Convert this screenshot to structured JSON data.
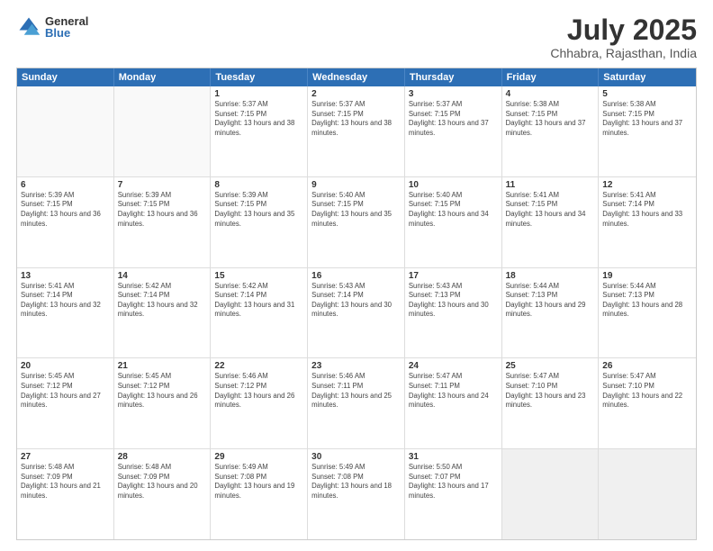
{
  "logo": {
    "general": "General",
    "blue": "Blue"
  },
  "header": {
    "title": "July 2025",
    "subtitle": "Chhabra, Rajasthan, India"
  },
  "calendar": {
    "days": [
      "Sunday",
      "Monday",
      "Tuesday",
      "Wednesday",
      "Thursday",
      "Friday",
      "Saturday"
    ],
    "rows": [
      [
        {
          "day": "",
          "text": ""
        },
        {
          "day": "",
          "text": ""
        },
        {
          "day": "1",
          "text": "Sunrise: 5:37 AM\nSunset: 7:15 PM\nDaylight: 13 hours and 38 minutes."
        },
        {
          "day": "2",
          "text": "Sunrise: 5:37 AM\nSunset: 7:15 PM\nDaylight: 13 hours and 38 minutes."
        },
        {
          "day": "3",
          "text": "Sunrise: 5:37 AM\nSunset: 7:15 PM\nDaylight: 13 hours and 37 minutes."
        },
        {
          "day": "4",
          "text": "Sunrise: 5:38 AM\nSunset: 7:15 PM\nDaylight: 13 hours and 37 minutes."
        },
        {
          "day": "5",
          "text": "Sunrise: 5:38 AM\nSunset: 7:15 PM\nDaylight: 13 hours and 37 minutes."
        }
      ],
      [
        {
          "day": "6",
          "text": "Sunrise: 5:39 AM\nSunset: 7:15 PM\nDaylight: 13 hours and 36 minutes."
        },
        {
          "day": "7",
          "text": "Sunrise: 5:39 AM\nSunset: 7:15 PM\nDaylight: 13 hours and 36 minutes."
        },
        {
          "day": "8",
          "text": "Sunrise: 5:39 AM\nSunset: 7:15 PM\nDaylight: 13 hours and 35 minutes."
        },
        {
          "day": "9",
          "text": "Sunrise: 5:40 AM\nSunset: 7:15 PM\nDaylight: 13 hours and 35 minutes."
        },
        {
          "day": "10",
          "text": "Sunrise: 5:40 AM\nSunset: 7:15 PM\nDaylight: 13 hours and 34 minutes."
        },
        {
          "day": "11",
          "text": "Sunrise: 5:41 AM\nSunset: 7:15 PM\nDaylight: 13 hours and 34 minutes."
        },
        {
          "day": "12",
          "text": "Sunrise: 5:41 AM\nSunset: 7:14 PM\nDaylight: 13 hours and 33 minutes."
        }
      ],
      [
        {
          "day": "13",
          "text": "Sunrise: 5:41 AM\nSunset: 7:14 PM\nDaylight: 13 hours and 32 minutes."
        },
        {
          "day": "14",
          "text": "Sunrise: 5:42 AM\nSunset: 7:14 PM\nDaylight: 13 hours and 32 minutes."
        },
        {
          "day": "15",
          "text": "Sunrise: 5:42 AM\nSunset: 7:14 PM\nDaylight: 13 hours and 31 minutes."
        },
        {
          "day": "16",
          "text": "Sunrise: 5:43 AM\nSunset: 7:14 PM\nDaylight: 13 hours and 30 minutes."
        },
        {
          "day": "17",
          "text": "Sunrise: 5:43 AM\nSunset: 7:13 PM\nDaylight: 13 hours and 30 minutes."
        },
        {
          "day": "18",
          "text": "Sunrise: 5:44 AM\nSunset: 7:13 PM\nDaylight: 13 hours and 29 minutes."
        },
        {
          "day": "19",
          "text": "Sunrise: 5:44 AM\nSunset: 7:13 PM\nDaylight: 13 hours and 28 minutes."
        }
      ],
      [
        {
          "day": "20",
          "text": "Sunrise: 5:45 AM\nSunset: 7:12 PM\nDaylight: 13 hours and 27 minutes."
        },
        {
          "day": "21",
          "text": "Sunrise: 5:45 AM\nSunset: 7:12 PM\nDaylight: 13 hours and 26 minutes."
        },
        {
          "day": "22",
          "text": "Sunrise: 5:46 AM\nSunset: 7:12 PM\nDaylight: 13 hours and 26 minutes."
        },
        {
          "day": "23",
          "text": "Sunrise: 5:46 AM\nSunset: 7:11 PM\nDaylight: 13 hours and 25 minutes."
        },
        {
          "day": "24",
          "text": "Sunrise: 5:47 AM\nSunset: 7:11 PM\nDaylight: 13 hours and 24 minutes."
        },
        {
          "day": "25",
          "text": "Sunrise: 5:47 AM\nSunset: 7:10 PM\nDaylight: 13 hours and 23 minutes."
        },
        {
          "day": "26",
          "text": "Sunrise: 5:47 AM\nSunset: 7:10 PM\nDaylight: 13 hours and 22 minutes."
        }
      ],
      [
        {
          "day": "27",
          "text": "Sunrise: 5:48 AM\nSunset: 7:09 PM\nDaylight: 13 hours and 21 minutes."
        },
        {
          "day": "28",
          "text": "Sunrise: 5:48 AM\nSunset: 7:09 PM\nDaylight: 13 hours and 20 minutes."
        },
        {
          "day": "29",
          "text": "Sunrise: 5:49 AM\nSunset: 7:08 PM\nDaylight: 13 hours and 19 minutes."
        },
        {
          "day": "30",
          "text": "Sunrise: 5:49 AM\nSunset: 7:08 PM\nDaylight: 13 hours and 18 minutes."
        },
        {
          "day": "31",
          "text": "Sunrise: 5:50 AM\nSunset: 7:07 PM\nDaylight: 13 hours and 17 minutes."
        },
        {
          "day": "",
          "text": ""
        },
        {
          "day": "",
          "text": ""
        }
      ]
    ]
  }
}
